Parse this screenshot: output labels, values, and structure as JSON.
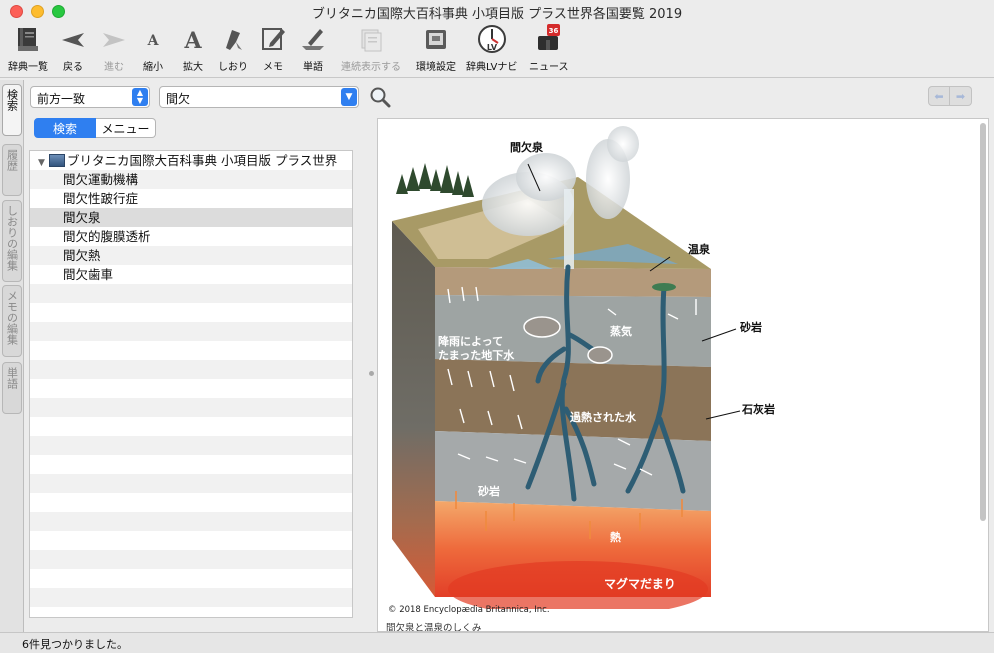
{
  "window": {
    "title": "ブリタニカ国際大百科事典 小項目版 プラス世界各国要覧 2019"
  },
  "toolbar": {
    "items": [
      {
        "label": "辞典一覧",
        "icon": "dictionary-list-icon",
        "enabled": true
      },
      {
        "label": "戻る",
        "icon": "back-arrow-icon",
        "enabled": true
      },
      {
        "label": "進む",
        "icon": "forward-arrow-icon",
        "enabled": false
      },
      {
        "label": "縮小",
        "icon": "font-smaller-icon",
        "enabled": true
      },
      {
        "label": "拡大",
        "icon": "font-larger-icon",
        "enabled": true
      },
      {
        "label": "しおり",
        "icon": "bookmark-icon",
        "enabled": true
      },
      {
        "label": "メモ",
        "icon": "memo-icon",
        "enabled": true
      },
      {
        "label": "単語",
        "icon": "word-icon",
        "enabled": true
      },
      {
        "label": "連続表示する",
        "icon": "continuous-display-icon",
        "enabled": false
      },
      {
        "label": "環境設定",
        "icon": "preferences-icon",
        "enabled": true
      },
      {
        "label": "辞典LVナビ",
        "icon": "lv-navi-icon",
        "enabled": true
      },
      {
        "label": "ニュース",
        "icon": "news-icon",
        "enabled": true,
        "badge": "36"
      }
    ]
  },
  "side_tabs": [
    {
      "label": "検索",
      "active": true
    },
    {
      "label": "履歴",
      "active": false
    },
    {
      "label": "しおりの編集",
      "active": false
    },
    {
      "label": "メモの編集",
      "active": false
    },
    {
      "label": "単語",
      "active": false
    }
  ],
  "search": {
    "mode": "前方一致",
    "query": "間欠",
    "view_tabs": [
      {
        "label": "検索",
        "active": true
      },
      {
        "label": "メニュー",
        "active": false
      }
    ]
  },
  "results": {
    "dictionary": "ブリタニカ国際大百科事典 小項目版 プラス世界",
    "items": [
      "間欠運動機構",
      "間欠性跛行症",
      "間欠泉",
      "間欠的腹膜透析",
      "間欠熱",
      "間欠歯車"
    ],
    "selected_index": 2
  },
  "figure": {
    "labels": {
      "geyser": "間欠泉",
      "hot_spring": "温泉",
      "sandstone_right": "砂岩",
      "limestone": "石灰岩",
      "rain_water_1": "降雨によって",
      "rain_water_2": "たまった地下水",
      "steam": "蒸気",
      "superheated": "過熱された水",
      "sandstone_bottom": "砂岩",
      "heat": "熱",
      "magma": "マグマだまり"
    },
    "credit": "© 2018 Encyclopædia Britannica, Inc.",
    "caption": "間欠泉と温泉のしくみ"
  },
  "status": {
    "text": "6件見つかりました。"
  },
  "colors": {
    "accent": "#2f7ff0",
    "magma": "#e8432a",
    "water": "#2e5d74"
  }
}
